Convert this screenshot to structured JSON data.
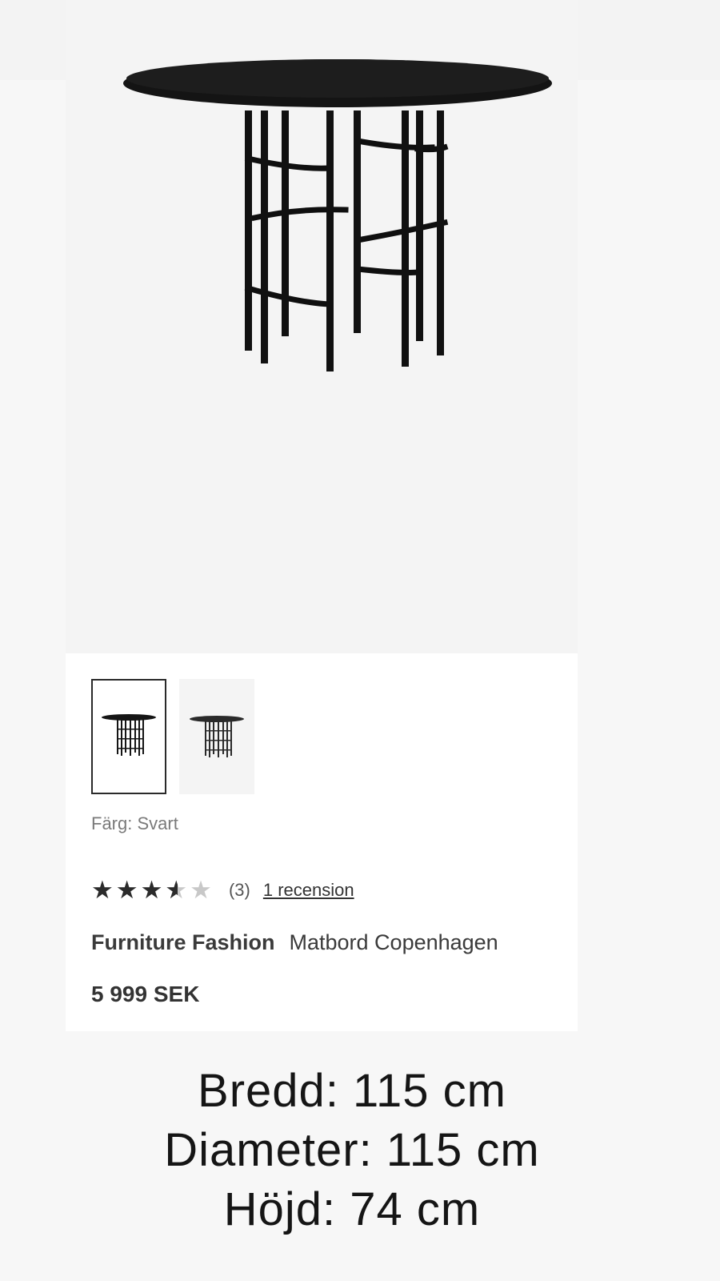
{
  "product": {
    "color_label": "Färg: Svart",
    "rating": {
      "value": 3.5,
      "max": 5,
      "stars_glyphs": "★★★★★",
      "count_text": "(3)",
      "reviews_link": "1 recension"
    },
    "brand": "Furniture Fashion",
    "name": "Matbord Copenhagen",
    "price": "5 999 SEK"
  },
  "thumbnails": [
    {
      "selected": true
    },
    {
      "selected": false
    }
  ],
  "dimensions": {
    "width": "Bredd: 115 cm",
    "diameter": "Diameter: 115 cm",
    "height": "Höjd: 74 cm"
  },
  "colors": {
    "image_bg": "#f4f4f4",
    "table_black": "#111111",
    "text_dark": "#333333",
    "star_filled": "#2b2b2b",
    "star_empty": "#c8c8c8"
  }
}
